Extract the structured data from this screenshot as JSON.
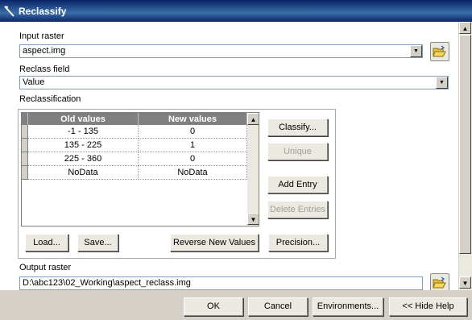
{
  "window": {
    "title": "Reclassify"
  },
  "input_raster": {
    "label": "Input raster",
    "value": "aspect.img"
  },
  "reclass_field": {
    "label": "Reclass field",
    "value": "Value"
  },
  "reclassification": {
    "label": "Reclassification",
    "columns": [
      "Old values",
      "New values"
    ],
    "rows": [
      {
        "old": "-1 - 135",
        "new": "0"
      },
      {
        "old": "135 - 225",
        "new": "1"
      },
      {
        "old": "225 - 360",
        "new": "0"
      },
      {
        "old": "NoData",
        "new": "NoData"
      }
    ],
    "side_buttons": {
      "classify": "Classify...",
      "unique": "Unique",
      "add_entry": "Add Entry",
      "delete_entries": "Delete Entries"
    },
    "bottom_buttons": {
      "load": "Load...",
      "save": "Save...",
      "reverse": "Reverse New Values",
      "precision": "Precision..."
    }
  },
  "output_raster": {
    "label": "Output raster",
    "value": "D:\\abc123\\02_Working\\aspect_reclass.img"
  },
  "footer": {
    "ok": "OK",
    "cancel": "Cancel",
    "environments": "Environments...",
    "hide_help": "<< Hide Help"
  },
  "icons": {
    "title": "reclassify-tool-icon",
    "browse": "open-folder-icon",
    "dropdown": "chevron-down-icon"
  }
}
